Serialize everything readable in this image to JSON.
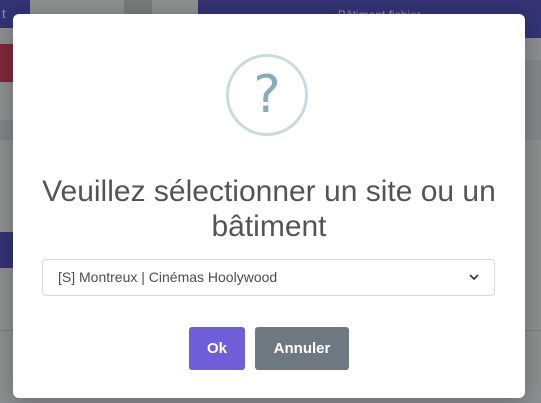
{
  "background": {
    "top_button_label": "t",
    "top_bar_label": "Bâtiment fichier"
  },
  "dialog": {
    "icon": "question-icon",
    "icon_glyph": "?",
    "title": "Veuillez sélectionner un site ou un bâtiment",
    "select": {
      "value": "[S] Montreux | Cinémas Hoolywood"
    },
    "buttons": {
      "ok_label": "Ok",
      "cancel_label": "Annuler"
    }
  },
  "colors": {
    "accent": "#6f5ed8",
    "cancel": "#6e7880",
    "icon_border": "#c9dae1",
    "icon_glyph": "#87adbd",
    "title_text": "#545454"
  }
}
